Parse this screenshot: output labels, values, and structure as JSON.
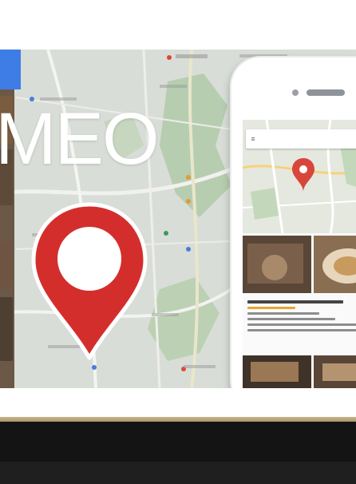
{
  "banner": {
    "title": "MEO",
    "pin_icon": "map-pin-icon",
    "pin_color": "#d42e2c",
    "accent_blue": "#3f7de6"
  },
  "phone": {
    "search_query": "",
    "menu_icon": "hamburger-icon"
  },
  "footer": {
    "caption": "",
    "rule_color": "#b8a67a",
    "background": "#141414"
  }
}
